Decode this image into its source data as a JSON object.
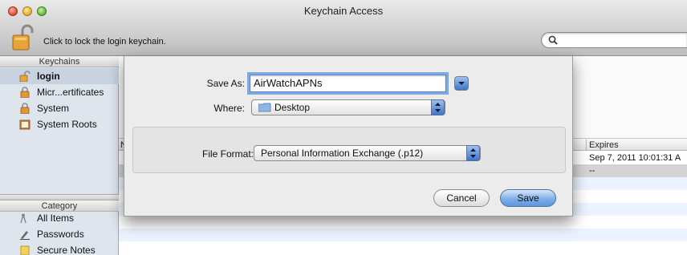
{
  "window": {
    "title": "Keychain Access"
  },
  "toolbar": {
    "lock_label": "Click to lock the login keychain.",
    "search_placeholder": ""
  },
  "sidebar": {
    "keychains_header": "Keychains",
    "keychains": [
      {
        "label": "login",
        "icon": "open-lock-icon",
        "selected": true
      },
      {
        "label": "Micr...ertificates",
        "icon": "lock-icon",
        "selected": false
      },
      {
        "label": "System",
        "icon": "lock-icon",
        "selected": false
      },
      {
        "label": "System Roots",
        "icon": "cabinet-icon",
        "selected": false
      }
    ],
    "category_header": "Category",
    "categories": [
      {
        "label": "All Items",
        "icon": "people-icon"
      },
      {
        "label": "Passwords",
        "icon": "pencil-icon"
      },
      {
        "label": "Secure Notes",
        "icon": "note-icon"
      }
    ]
  },
  "table": {
    "columns": [
      "N",
      "Expires"
    ],
    "rows": [
      {
        "expires": "Sep 7, 2011 10:01:31 A"
      },
      {
        "expires": "--"
      }
    ]
  },
  "sheet": {
    "save_as_label": "Save As:",
    "save_as_value": "AirWatchAPNs",
    "where_label": "Where:",
    "where_value": "Desktop",
    "file_format_label": "File Format:",
    "file_format_value": "Personal Information Exchange (.p12)",
    "cancel_label": "Cancel",
    "save_label": "Save"
  },
  "colors": {
    "accent": "#5d96e0",
    "sidebar_bg": "#dfe5ec",
    "selection": "#c9d3df"
  }
}
